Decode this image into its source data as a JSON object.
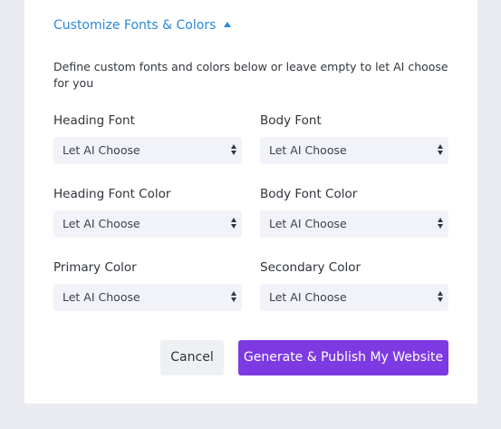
{
  "toggle": {
    "label": "Customize Fonts & Colors"
  },
  "description": "Define custom fonts and colors below or leave empty to let AI choose for you",
  "fields": {
    "heading_font": {
      "label": "Heading Font",
      "value": "Let AI Choose"
    },
    "body_font": {
      "label": "Body Font",
      "value": "Let AI Choose"
    },
    "heading_font_color": {
      "label": "Heading Font Color",
      "value": "Let AI Choose"
    },
    "body_font_color": {
      "label": "Body Font Color",
      "value": "Let AI Choose"
    },
    "primary_color": {
      "label": "Primary Color",
      "value": "Let AI Choose"
    },
    "secondary_color": {
      "label": "Secondary Color",
      "value": "Let AI Choose"
    }
  },
  "buttons": {
    "cancel": "Cancel",
    "generate": "Generate & Publish My Website"
  },
  "colors": {
    "accent_link": "#2b87da",
    "primary_button": "#7d3ae2",
    "select_bg": "#f1f3f8"
  },
  "icons": {
    "toggle": "caret-up-icon",
    "select": "select-arrows-icon"
  }
}
